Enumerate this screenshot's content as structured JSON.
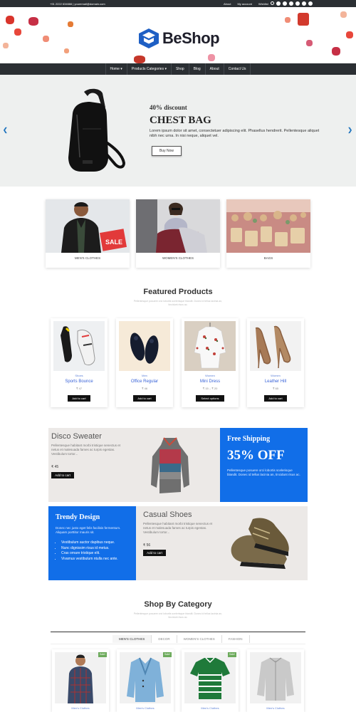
{
  "topbar": {
    "contact": "+91 2222 634666 | youremail@domain.com",
    "links": [
      "About",
      "My account",
      "Wishlist"
    ],
    "icons": [
      "search-icon",
      "facebook-icon",
      "pinterest-icon",
      "twitter-icon",
      "youtube-icon",
      "instagram-icon",
      "dribbble-icon"
    ]
  },
  "brand": {
    "name": "BeShop",
    "color": "#1e73be"
  },
  "nav": {
    "items": [
      "Home ▾",
      "Products Categories ▾",
      "Shop",
      "Blog",
      "About",
      "Contact Us"
    ]
  },
  "hero": {
    "discount": "40% discount",
    "title": "CHEST BAG",
    "description": "Lorem ipsum dolor sit amet, consectetuer adipiscing elit. Phasellus hendrerit. Pellentesque aliquet nibh nec urna. In nisi neque, aliquet vel.",
    "button": "Buy Now",
    "prev_icon": "chevron-left-icon",
    "next_icon": "chevron-right-icon"
  },
  "categories": [
    {
      "label": "MEN'S CLOTHES"
    },
    {
      "label": "WOMEN'S CLOTHES"
    },
    {
      "label": "BAGS"
    }
  ],
  "featured": {
    "title": "Featured Products",
    "subtitle": "Pellentesque posuere orci lobortis scelerisque blandit. Donec id tellus lacinia an, tincidunt risus ac.",
    "products": [
      {
        "category": "Shoes",
        "name": "Sports Bounce",
        "price": "₹ 47",
        "button": "Add to cart"
      },
      {
        "category": "Men",
        "name": "Office Regular",
        "price": "₹ 46",
        "button": "Add to cart"
      },
      {
        "category": "Women",
        "name": "Mini Dress",
        "price": "₹ 15 – ₹ 20",
        "button": "Select options"
      },
      {
        "category": "Women",
        "name": "Leather Hill",
        "price": "₹ 65",
        "button": "Add to cart"
      }
    ]
  },
  "promos": {
    "disco": {
      "title": "Disco Sweater",
      "text": "Pellentesque habitant morbi tristique senectus et netus et malesuada fames ac turpis egestas. Vestibulum tortor...",
      "price": "₹ 45",
      "button": "Add to cart"
    },
    "shipping": {
      "title": "Free Shipping",
      "headline": "35% OFF",
      "text": "Pellentesque posuere orci lobortis scelerisque blandit. Donec id tellus lacinia an, tincidunt risus ac."
    },
    "trendy": {
      "title": "Trendy Design",
      "text": "Donec nec justo eget felis facilisis fermentum. Aliquam porttitor mauris sit.",
      "bullets": [
        "Vestibulum auctor dapibus neque.",
        "Nunc dignissim risus id metus.",
        "Cras ornare tristique elit.",
        "Vivamus vestibulum ntulla nec ante."
      ]
    },
    "casual": {
      "title": "Casual Shoes",
      "text": "Pellentesque habitant morbi tristique senectus et netus et malesuada fames ac turpis egestas. Vestibulum tortor...",
      "price": "₹ 56",
      "button": "Add to cart"
    }
  },
  "shop_by_category": {
    "title": "Shop By Category",
    "subtitle": "Pellentesque posuere orci lobortis scelerisque blandit. Donec id tellus lacinia an, tincidunt risus ac.",
    "tabs": [
      "MEN'S CLOTHES",
      "DECOR",
      "WOMEN'S CLOTHES",
      "FASHION"
    ],
    "active_tab": "MEN'S CLOTHES",
    "items": [
      {
        "badge": "Sale!",
        "category": "Men's Clothes"
      },
      {
        "badge": "Sale!",
        "category": "Men's Clothes"
      },
      {
        "badge": "Sale!",
        "category": "Men's Clothes"
      },
      {
        "badge": "",
        "category": "Men's Clothes"
      }
    ]
  }
}
